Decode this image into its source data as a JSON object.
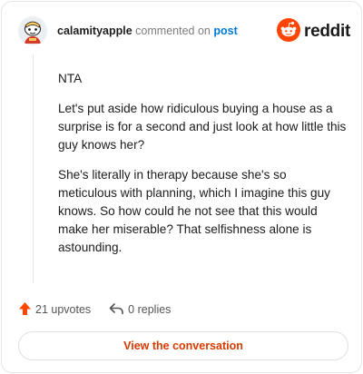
{
  "header": {
    "username": "calamityapple",
    "action_text": "commented on",
    "post_link": "post",
    "brand": "reddit",
    "avatar_icon": "snoo-avatar-icon"
  },
  "comment": {
    "paragraphs": [
      "NTA",
      "Let's put aside how ridiculous buying a house as a surprise is for a second and just look at how little this guy knows her?",
      "She's literally in therapy because she's so meticulous with planning, which I imagine this guy knows. So how could he not see that this would make her miserable? That selfishness alone is astounding."
    ]
  },
  "actions": {
    "upvotes": "21 upvotes",
    "replies": "0 replies"
  },
  "cta": {
    "label": "View the conversation"
  },
  "colors": {
    "brand_orange": "#ff4500",
    "link_blue": "#0079d3",
    "cta_text": "#d93a00"
  }
}
